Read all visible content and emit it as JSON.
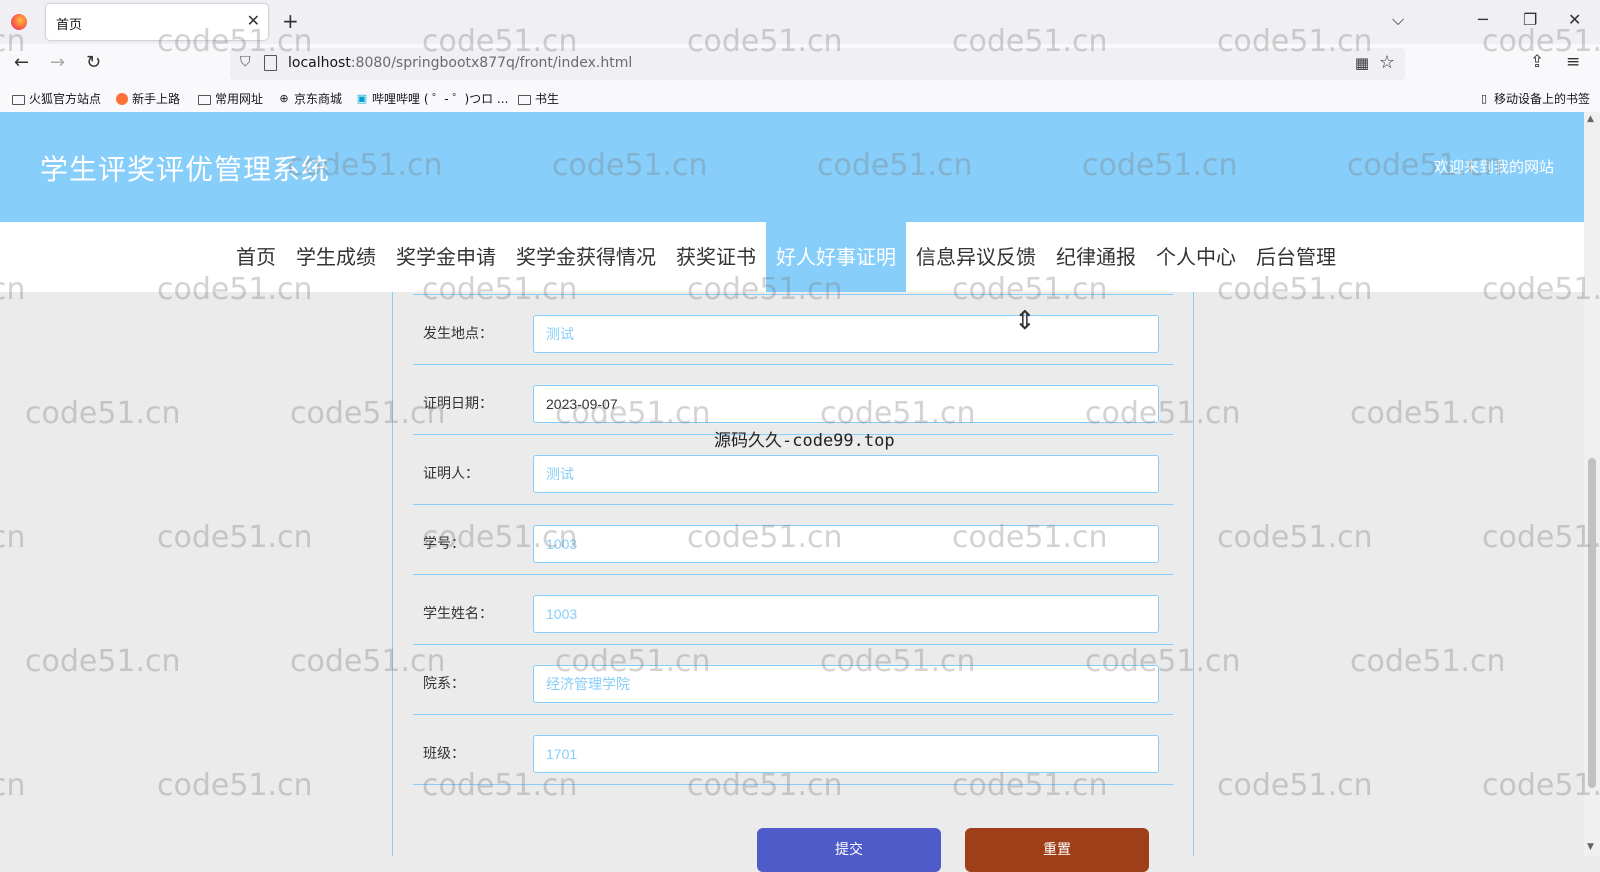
{
  "browser": {
    "tab_title": "首页",
    "tab_close": "✕",
    "new_tab": "+",
    "url_host": "localhost",
    "url_rest": ":8080/springbootx877q/front/index.html",
    "bookmarks": [
      "火狐官方站点",
      "新手上路",
      "常用网址",
      "京东商城",
      "哔哩哔哩 ( ゜- ゜)つロ ...",
      "书生"
    ],
    "mobile_bookmarks": "移动设备上的书签"
  },
  "site": {
    "title": "学生评奖评优管理系统",
    "welcome": "欢迎来到我的网站"
  },
  "nav": {
    "items": [
      "首页",
      "学生成绩",
      "奖学金申请",
      "奖学金获得情况",
      "获奖证书",
      "好人好事证明",
      "信息异议反馈",
      "纪律通报",
      "个人中心",
      "后台管理"
    ],
    "active": "好人好事证明"
  },
  "form": {
    "rows": [
      {
        "label": "发生地点：",
        "value": "测试"
      },
      {
        "label": "证明日期：",
        "value": "2023-09-07"
      },
      {
        "label": "证明人：",
        "value": "测试"
      },
      {
        "label": "学号：",
        "value": "1003"
      },
      {
        "label": "学生姓名：",
        "value": "1003"
      },
      {
        "label": "院系：",
        "value": "经济管理学院"
      },
      {
        "label": "班级：",
        "value": "1701"
      }
    ],
    "submit_label": "提交",
    "reset_label": "重置"
  },
  "watermark": {
    "text": "code51.cn",
    "center_text": "源码久久-code99.top"
  },
  "colors": {
    "primary": "#87cefa",
    "submit": "#4e5bc8",
    "reset": "#9e3f1a"
  }
}
